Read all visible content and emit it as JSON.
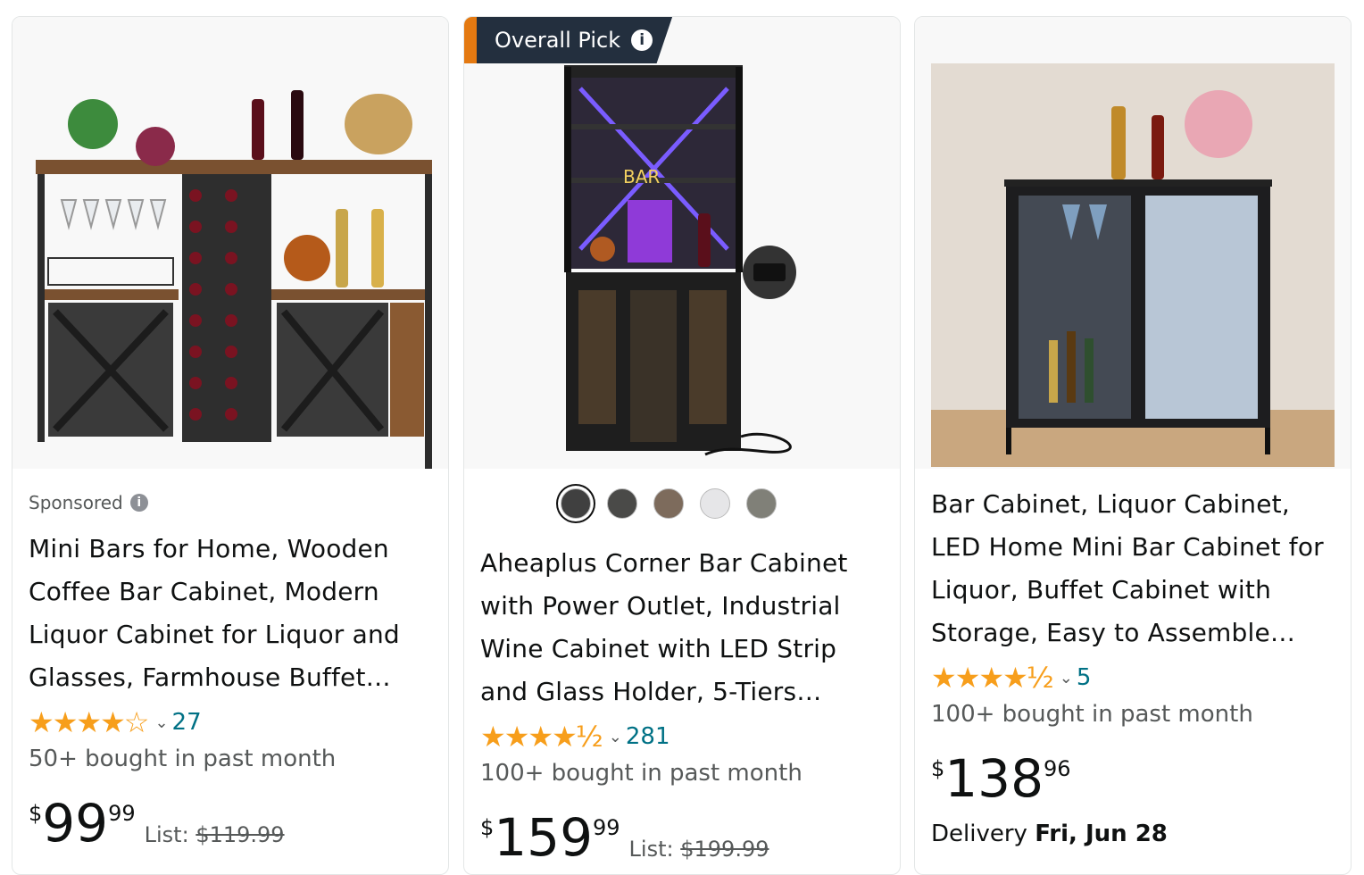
{
  "products": [
    {
      "sponsored_label": "Sponsored",
      "title": "Mini Bars for Home, Wooden Coffee Bar Cabinet, Modern Liquor Cabinet for Liquor and Glasses, Farmhouse Buffet…",
      "stars": "★★★★☆",
      "rating_value": 3.9,
      "review_count": "27",
      "bought": "50+ bought in past month",
      "price_currency": "$",
      "price_whole": "99",
      "price_fraction": "99",
      "list_label": "List:",
      "list_price": "$119.99"
    },
    {
      "badge": "Overall Pick",
      "title": "Aheaplus Corner Bar Cabinet with Power Outlet, Industrial Wine Cabinet with LED Strip and Glass Holder, 5-Tiers…",
      "stars": "★★★★½",
      "rating_value": 4.5,
      "review_count": "281",
      "bought": "100+ bought in past month",
      "price_currency": "$",
      "price_whole": "159",
      "price_fraction": "99",
      "list_label": "List:",
      "list_price": "$199.99",
      "swatch_colors": [
        "#404040",
        "#4a4a48",
        "#7d6b5c",
        "#e6e6e8",
        "#808078"
      ],
      "selected_swatch": 0
    },
    {
      "title": "Bar Cabinet, Liquor Cabinet, LED Home Mini Bar Cabinet for Liquor, Buffet Cabinet with Storage, Easy to Assemble…",
      "stars": "★★★★½",
      "rating_value": 4.5,
      "review_count": "5",
      "bought": "100+ bought in past month",
      "price_currency": "$",
      "price_whole": "138",
      "price_fraction": "96",
      "delivery_label": "Delivery",
      "delivery_date": "Fri, Jun 28"
    }
  ],
  "colors": {
    "link": "#007185",
    "star": "#F79E1B",
    "badge_bg": "#232F3E",
    "badge_accent": "#e47911"
  }
}
